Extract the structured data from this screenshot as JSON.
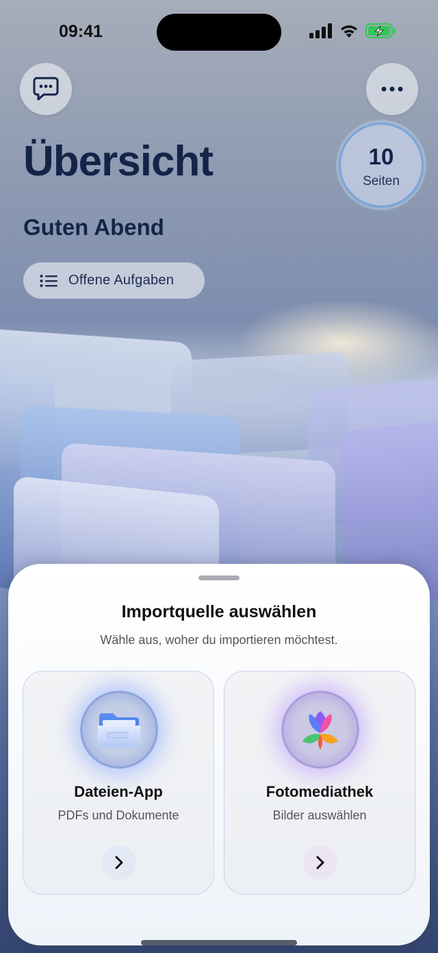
{
  "status_bar": {
    "time": "09:41"
  },
  "header": {
    "title": "Übersicht",
    "greeting": "Guten Abend",
    "chat_icon": "chat-bubble-icon",
    "more_icon": "ellipsis-icon",
    "pages_badge": {
      "count": "10",
      "label": "Seiten"
    },
    "tasks_button": {
      "label": "Offene Aufgaben",
      "icon": "list-icon"
    }
  },
  "import_sheet": {
    "title": "Importquelle auswählen",
    "subtitle": "Wähle aus, woher du importieren möchtest.",
    "options": [
      {
        "title": "Dateien-App",
        "description": "PDFs und Dokumente",
        "icon": "folder-icon",
        "accent": "#4a7bf0"
      },
      {
        "title": "Fotomediathek",
        "description": "Bilder auswählen",
        "icon": "photos-flower-icon",
        "accent": "#a070f0"
      }
    ]
  },
  "colors": {
    "title_text": "#142448",
    "battery_green": "#34c759"
  }
}
